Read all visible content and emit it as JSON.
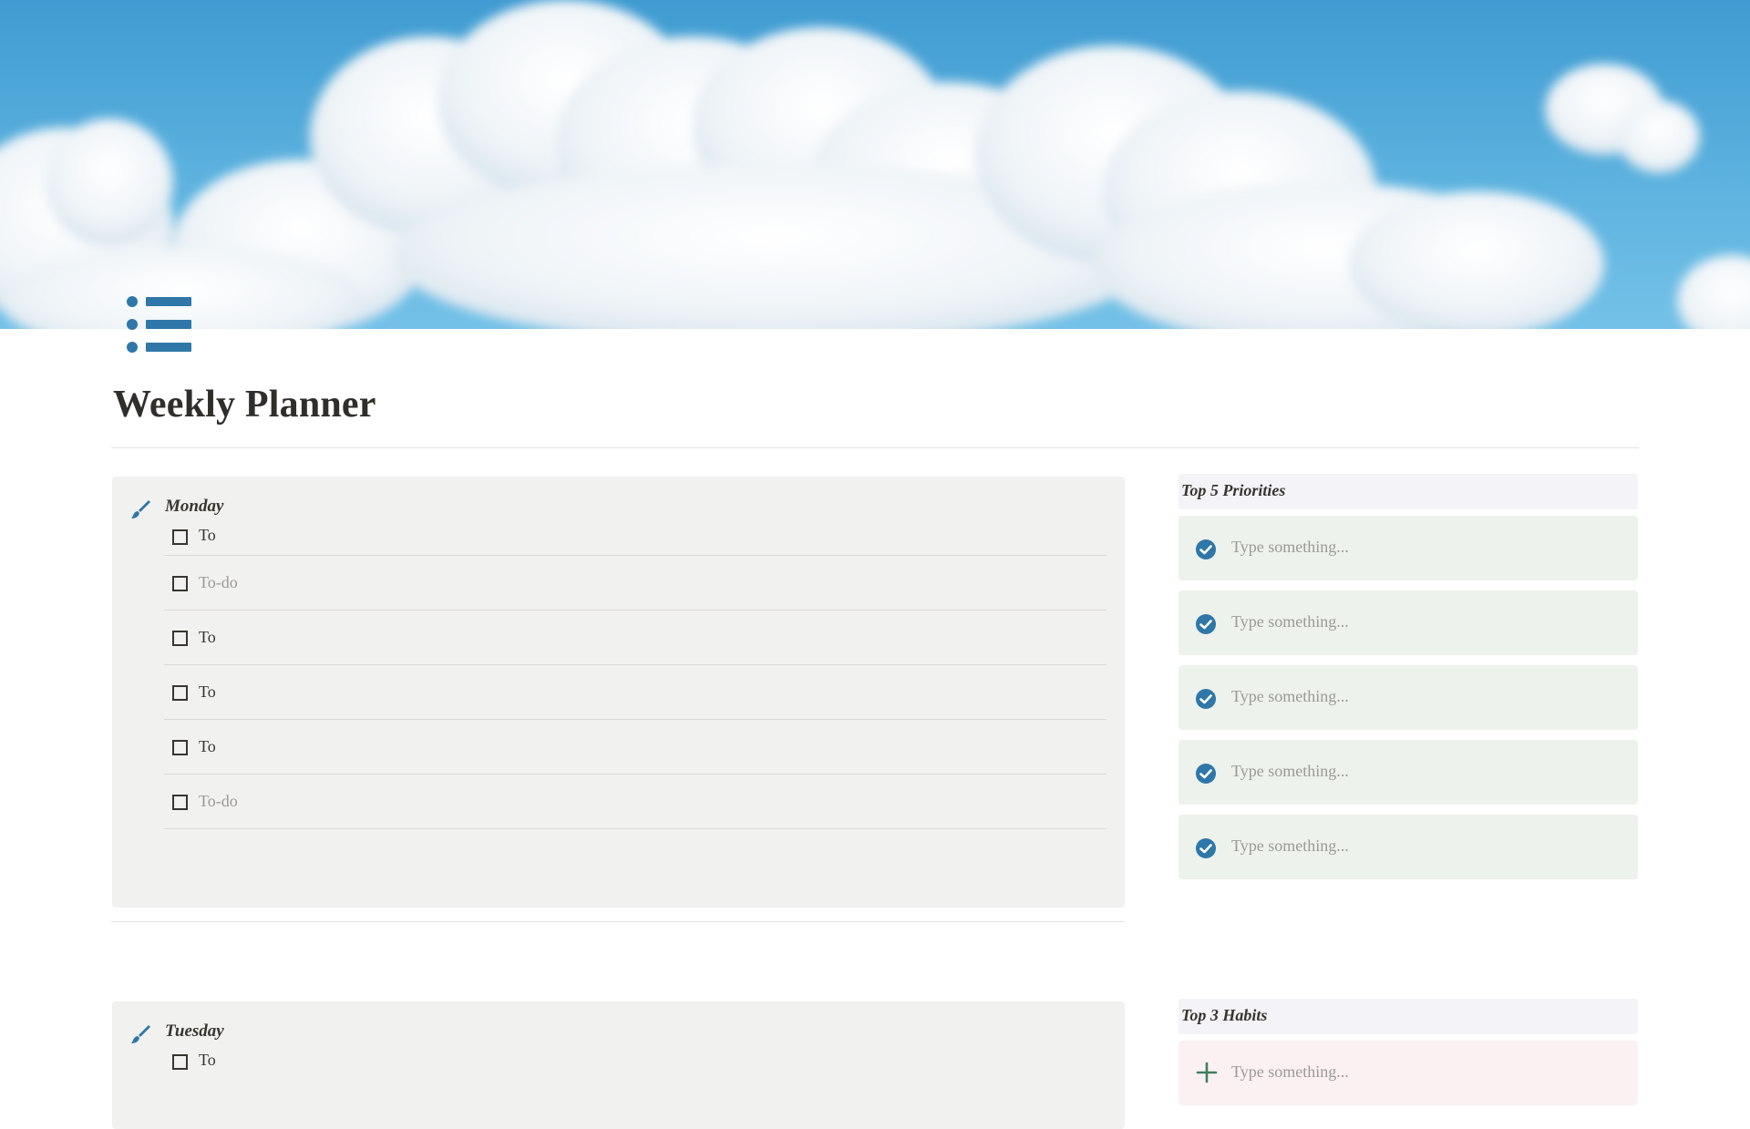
{
  "page": {
    "title": "Weekly Planner",
    "accent_color": "#2f77a8",
    "icon": "bulleted-list-icon",
    "cover": "sky-clouds-cover"
  },
  "days": [
    {
      "name": "Monday",
      "icon": "brush-icon",
      "todos": [
        {
          "label": "To",
          "placeholder": false,
          "checked": false
        },
        {
          "label": "To-do",
          "placeholder": true,
          "checked": false
        },
        {
          "label": "To",
          "placeholder": false,
          "checked": false
        },
        {
          "label": "To",
          "placeholder": false,
          "checked": false
        },
        {
          "label": "To",
          "placeholder": false,
          "checked": false
        },
        {
          "label": "To-do",
          "placeholder": true,
          "checked": false
        }
      ]
    },
    {
      "name": "Tuesday",
      "icon": "brush-icon",
      "todos": [
        {
          "label": "To",
          "placeholder": false,
          "checked": false
        }
      ]
    }
  ],
  "priorities": {
    "title": "Top 5 Priorities",
    "icon": "check-circle-icon",
    "items": [
      "Type something...",
      "Type something...",
      "Type something...",
      "Type something...",
      "Type something..."
    ]
  },
  "habits": {
    "title": "Top 3 Habits",
    "icon": "plus-icon",
    "items": [
      "Type something..."
    ]
  }
}
